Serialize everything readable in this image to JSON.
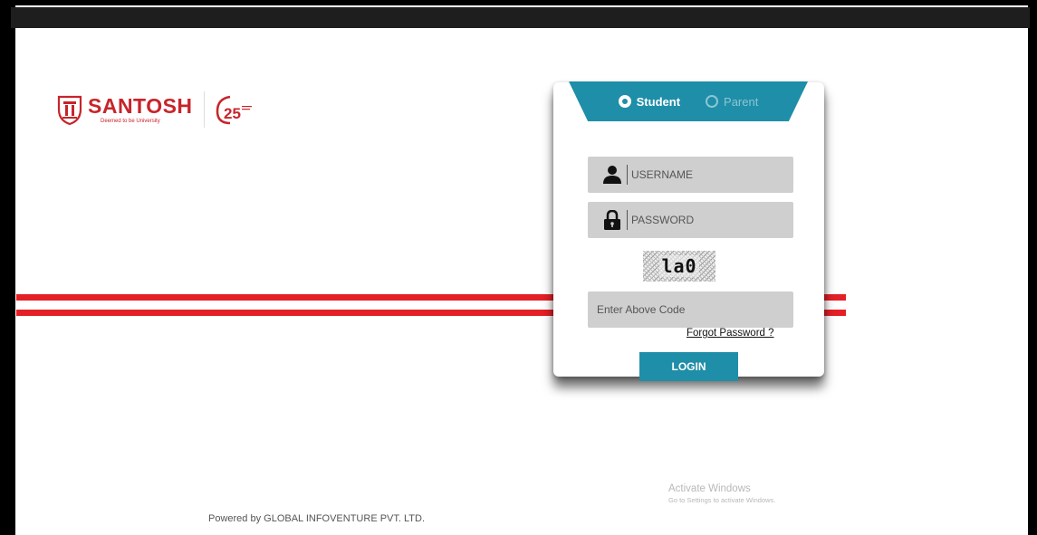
{
  "brand": {
    "name": "SANTOSH",
    "tagline": "Deemed to be University",
    "anniversary": "25"
  },
  "login": {
    "tabs": [
      {
        "label": "Student",
        "selected": true
      },
      {
        "label": "Parent",
        "selected": false
      }
    ],
    "username_placeholder": "USERNAME",
    "password_placeholder": "PASSWORD",
    "captcha_text": "la0",
    "code_placeholder": "Enter Above Code",
    "forgot_link": "Forgot Password ?",
    "login_button": "LOGIN"
  },
  "watermark": {
    "title": "Activate Windows",
    "subtitle": "Go to Settings to activate Windows."
  },
  "footer": {
    "powered_by": "Powered by GLOBAL INFOVENTURE PVT. LTD."
  },
  "colors": {
    "accent": "#1f8ea8",
    "brand_red": "#c7252b",
    "stripe_red": "#e42027",
    "field_bg": "#cfcfcf"
  },
  "icons": [
    "user-icon",
    "lock-icon",
    "radio-icon"
  ]
}
